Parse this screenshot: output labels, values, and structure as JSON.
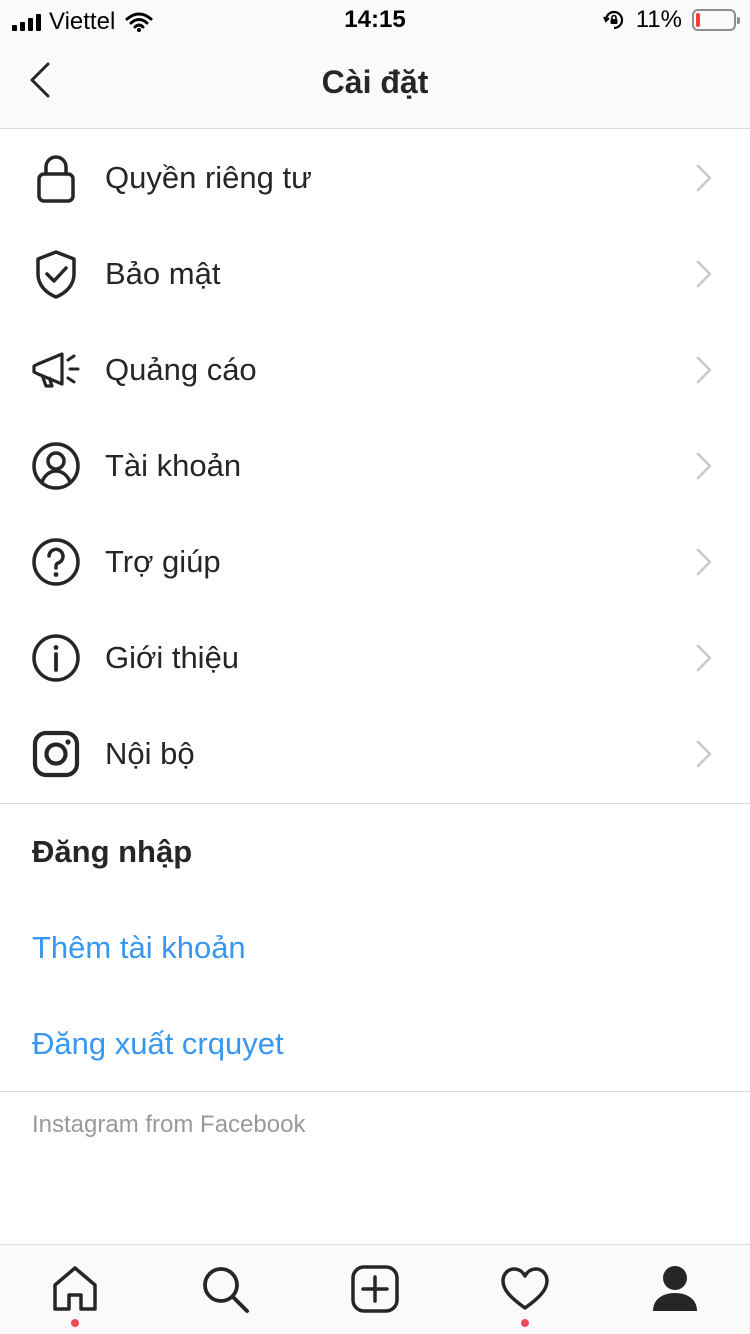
{
  "status_bar": {
    "carrier": "Viettel",
    "time": "14:15",
    "battery_percent": "11%",
    "battery_level": 0.11,
    "icons": [
      "signal-icon",
      "wifi-icon",
      "rotation-lock-icon",
      "battery-icon"
    ]
  },
  "header": {
    "title": "Cài đặt",
    "back_icon": "chevron-left-icon"
  },
  "menu": {
    "items": [
      {
        "label": "Quyền riêng tư",
        "icon": "lock-icon"
      },
      {
        "label": "Bảo mật",
        "icon": "shield-check-icon"
      },
      {
        "label": "Quảng cáo",
        "icon": "megaphone-icon"
      },
      {
        "label": "Tài khoản",
        "icon": "user-circle-icon"
      },
      {
        "label": "Trợ giúp",
        "icon": "help-circle-icon"
      },
      {
        "label": "Giới thiệu",
        "icon": "info-circle-icon"
      },
      {
        "label": "Nội bộ",
        "icon": "instagram-icon"
      }
    ]
  },
  "login": {
    "heading": "Đăng nhập",
    "add_account": "Thêm tài khoản",
    "logout": "Đăng xuất crquyet"
  },
  "footer": {
    "text": "Instagram from Facebook"
  },
  "tab_bar": {
    "tabs": [
      "home-icon",
      "search-icon",
      "add-post-icon",
      "activity-heart-icon",
      "profile-icon"
    ]
  },
  "colors": {
    "link": "#3897f0",
    "text": "#262626",
    "muted": "#999999",
    "notification_dot": "#ed4956",
    "battery_low": "#ff3b30"
  }
}
